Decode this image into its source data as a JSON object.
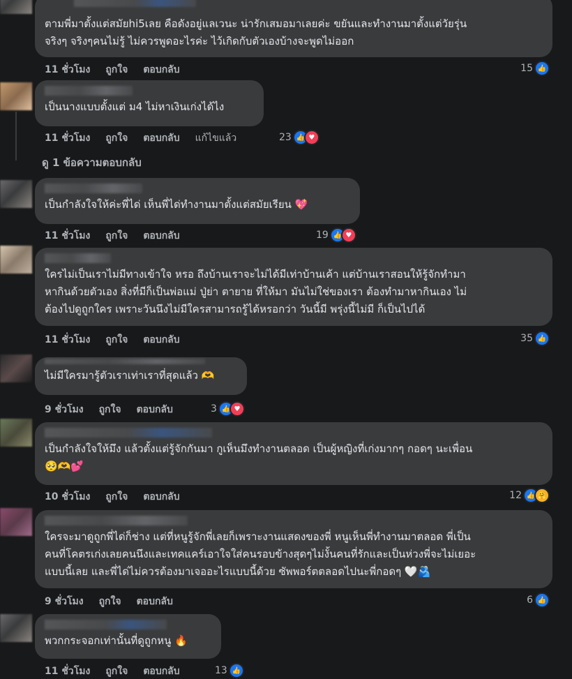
{
  "labels": {
    "like": "ถูกใจ",
    "reply": "ตอบกลับ",
    "edited": "แก้ไขแล้ว"
  },
  "comments": [
    {
      "text": "ตามพี่มาตั้งแต่สมัยhi5เลย คือดังอยู่แลเวนะ น่ารักเสมอมาเลยค่ะ ขยันและทำงานมาตั้งแต่วัยรุ่น\nจริงๆ จริงๆคนไม่รู้ ไม่ควรพูดอะไรค่ะ ไว้เกิดกับตัวเองบ้างจะพูดไม่ออก",
      "time": "11 ชั่วโมง",
      "count": "15",
      "reactions": [
        "like"
      ]
    },
    {
      "text": "เป็นนางแบบตั้งแต่ ม4 ไม่หาเงินเก่งได้ไง",
      "time": "11 ชั่วโมง",
      "count": "23",
      "reactions": [
        "like",
        "love"
      ]
    },
    {
      "text": "เป็นกำลังใจให้ค่ะพี่ได่ เห็นพี่ได่ทำงานมาตั้งแต่สมัยเรียน 💖",
      "time": "11 ชั่วโมง",
      "count": "19",
      "reactions": [
        "like",
        "love"
      ]
    },
    {
      "text": "ใครไม่เป็นเราไม่มีทางเข้าใจ หรอ ถึงบ้านเราจะไม่ได้มีเท่าบ้านเค้า แต่บ้านเราสอนให้รู้จักทำมา\nหากินด้วยตัวเอง สิ่งที่มีก็เป็นพ่อแม่ ปู่ย่า ตายาย ที่ให้มา มันไม่ใช่ของเรา ต้องทำมาหากินเอง ไม่\nต้องไปดูถูกใคร เพราะวันนึงไม่มีใครสามารถรู้ได้หรอกว่า วันนี้มี พรุ่งนี้ไม่มี ก็เป็นไปได้",
      "time": "11 ชั่วโมง",
      "count": "35",
      "reactions": [
        "like"
      ]
    },
    {
      "text": "ไม่มีใครมารู้ตัวเราเท่าเราที่สุดแล้ว 🫶",
      "time": "9 ชั่วโมง",
      "count": "3",
      "reactions": [
        "like",
        "love"
      ]
    },
    {
      "text": "เป็นกำลังใจให้มึง แล้วตั้งแต่รู้จักกันมา กูเห็นมึงทำงานตลอด เป็นผู้หญิงที่เก่งมากๆ กอดๆ นะเพื่อน\n🥺🫶💕",
      "time": "10 ชั่วโมง",
      "count": "12",
      "reactions": [
        "like",
        "care"
      ]
    },
    {
      "text": "ใครจะมาดูถูกพี่ได่ก็ช่าง แต่ที่หนูรู้จักพี่เลยก็เพราะงานแสดงของพี่ หนูเห็นพี่ทำงานมาตลอด พี่เป็น\nคนที่โคตรเก่งเลยคนนึงและเทคแคร์เอาใจใส่คนรอบข้างสุดๆไม่งั้นคนที่รักและเป็นห่วงพี่จะไม่เยอะ\nแบบนี้เลย และพี่ได่ไม่ควรต้องมาเจออะไรแบบนี้ด้วย ซัพพอร์ตตลอดไปนะพี่กอดๆ 🤍🫂",
      "time": "9 ชั่วโมง",
      "count": "6",
      "reactions": [
        "like"
      ]
    },
    {
      "text": "พวกกระจอกเท่านั้นที่ดูถูกหนู 🔥",
      "time": "11 ชั่วโมง",
      "count": "13",
      "reactions": [
        "like"
      ]
    }
  ],
  "view_replies": "ดู 1 ข้อความตอบกลับ",
  "colors": {
    "background": "#18191a",
    "bubble": "#3a3b3c",
    "like": "#1877f2",
    "love": "#f33e58"
  }
}
